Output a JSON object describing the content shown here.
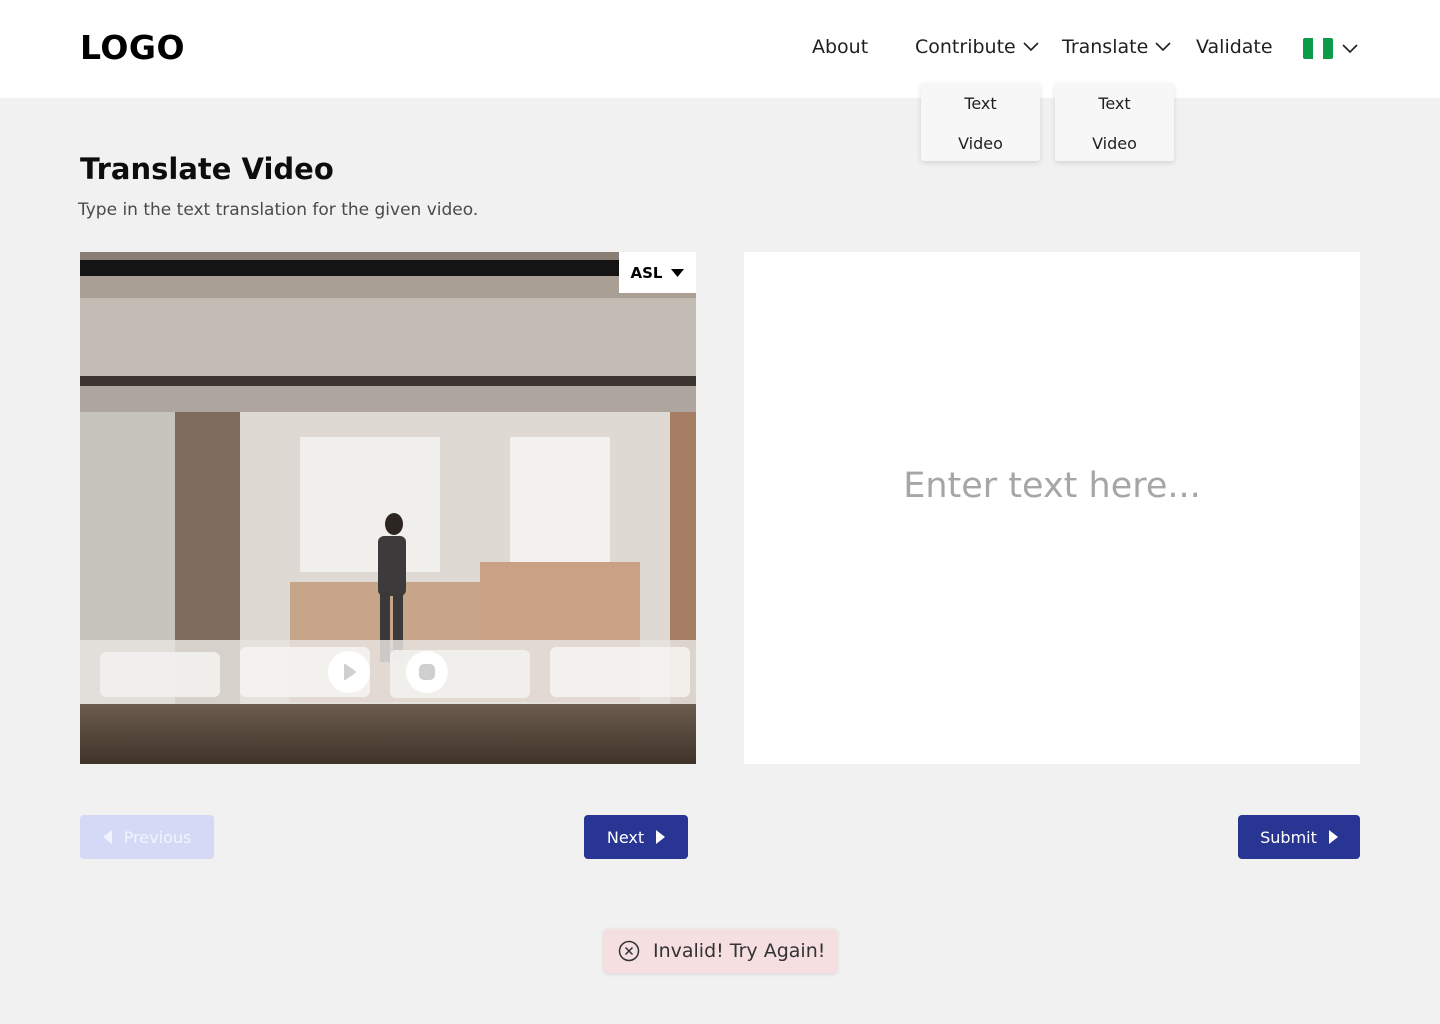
{
  "header": {
    "logo": "LOGO",
    "nav": {
      "about": "About",
      "contribute": "Contribute",
      "translate": "Translate",
      "validate": "Validate"
    },
    "language_flag": {
      "icon": "nigeria-flag-icon",
      "colors": [
        "#008751",
        "#ffffff",
        "#008751"
      ]
    }
  },
  "dropdowns": {
    "contribute": [
      "Text",
      "Video"
    ],
    "translate": [
      "Text",
      "Video"
    ]
  },
  "page": {
    "title": "Translate Video",
    "subtitle": "Type in the text translation for the given video."
  },
  "video": {
    "sign_language": "ASL",
    "controls": [
      "play-icon",
      "stop-icon"
    ]
  },
  "translation_input": {
    "placeholder": "Enter text here...",
    "value": ""
  },
  "buttons": {
    "previous": "Previous",
    "next": "Next",
    "submit": "Submit"
  },
  "toast": {
    "message": "Invalid! Try Again!",
    "icon": "error-circle-icon"
  },
  "colors": {
    "primary": "#283593",
    "primary_disabled": "#d4d9f5",
    "background": "#f1f1f2",
    "toast_error_bg": "#f5dfe0"
  }
}
